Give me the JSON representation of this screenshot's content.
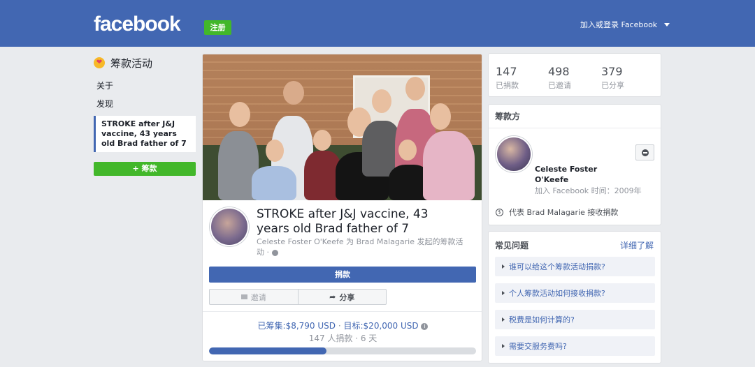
{
  "header": {
    "logo": "facebook",
    "signup_label": "注册",
    "login_label": "加入或登录 Facebook"
  },
  "leftnav": {
    "title": "筹款活动",
    "items": [
      {
        "label": "关于"
      },
      {
        "label": "发现"
      }
    ],
    "active_label": "STROKE after J&J vaccine, 43 years old Brad father of 7",
    "donate_label": "+ 筹款"
  },
  "campaign": {
    "title": "STROKE after J&J vaccine, 43 years old Brad father of 7",
    "subtitle": "Celeste Foster O'Keefe 为 Brad Malagarie 发起的筹款活动 ·",
    "donate_label": "捐款",
    "invite_label": "邀请",
    "share_label": "分享",
    "raised_label": "已筹集:",
    "raised_amount": "$8,790 USD",
    "goal_label": "目标:",
    "goal_amount": "$20,000 USD",
    "donors_text": "147 人捐款 · 6 天",
    "progress_fraction": 0.4395
  },
  "stats": [
    {
      "value": "147",
      "label": "已捐款"
    },
    {
      "value": "498",
      "label": "已邀请"
    },
    {
      "value": "379",
      "label": "已分享"
    }
  ],
  "organizer": {
    "heading": "筹款方",
    "name": "Celeste Foster O'Keefe",
    "joined": "加入 Facebook 时间：2009年",
    "on_behalf": "代表 Brad Malagarie 接收捐款"
  },
  "faq": {
    "heading": "常见问题",
    "more_label": "详细了解",
    "items": [
      {
        "label": "谁可以给这个筹款活动捐款?"
      },
      {
        "label": "个人筹款活动如何接收捐款?"
      },
      {
        "label": "税费是如何计算的?"
      },
      {
        "label": "需要交服务费吗?"
      }
    ]
  },
  "colors": {
    "brand": "#4267b2",
    "green": "#42b72a",
    "background": "#e9ebee"
  }
}
